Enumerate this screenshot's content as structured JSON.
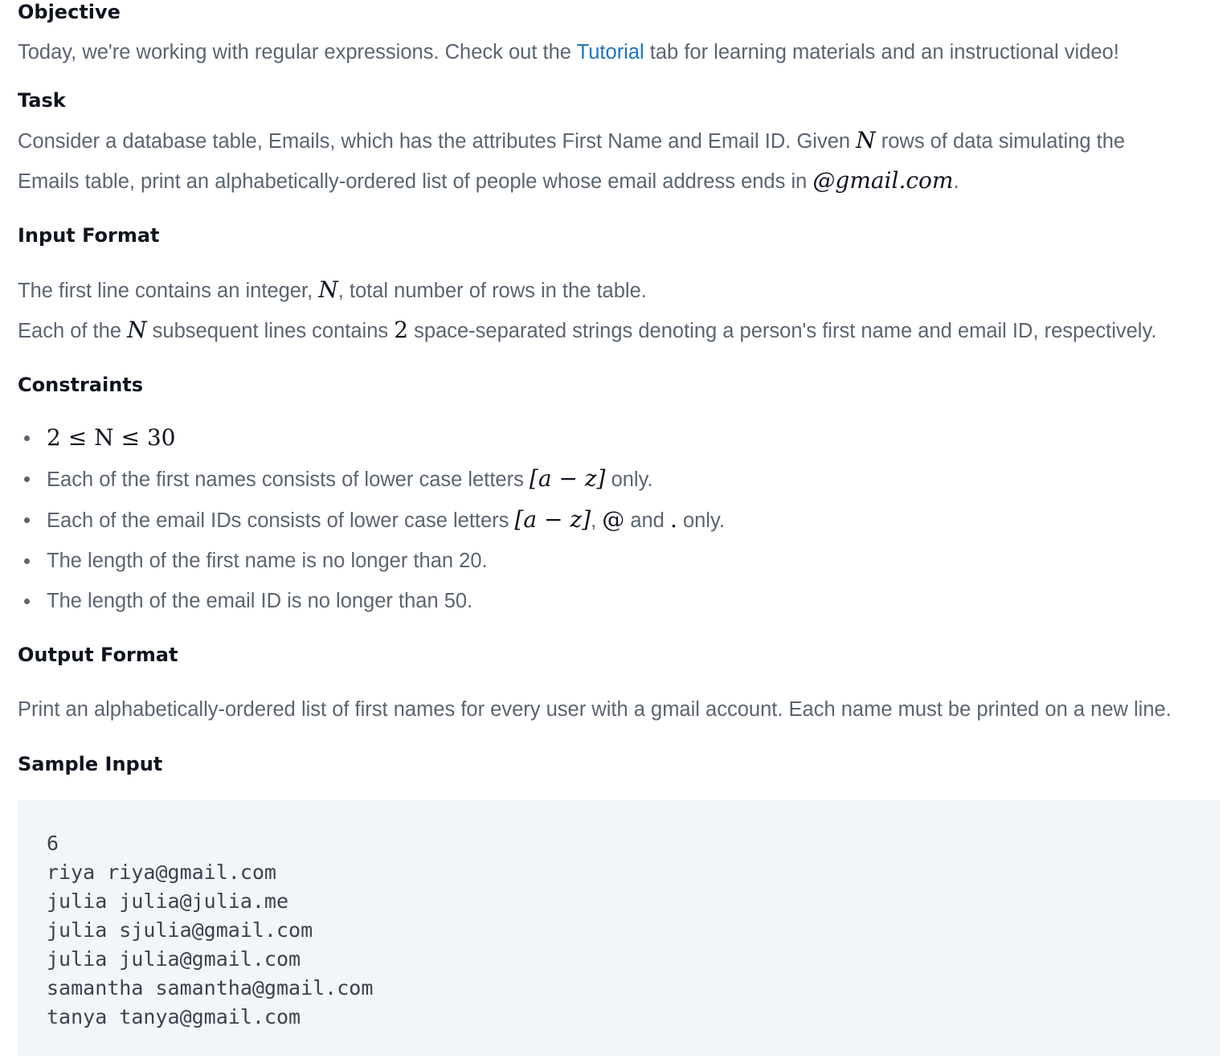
{
  "objective": {
    "heading": "Objective",
    "text_before": "Today, we're working with regular expressions. Check out the ",
    "link": "Tutorial",
    "text_after": " tab for learning materials and an instructional video!"
  },
  "task": {
    "heading": "Task",
    "line1_before": "Consider a database table, Emails, which has the attributes First Name and Email ID. Given ",
    "line1_var": "N",
    "line1_after": " rows of data simulating the",
    "line2_before": "Emails table, print an alphabetically-ordered list of people whose email address ends in ",
    "line2_math": "@gmail.com",
    "line2_after": "."
  },
  "input_format": {
    "heading": "Input Format",
    "line1_before": "The first line contains an integer, ",
    "line1_var": "N",
    "line1_after": ", total number of rows in the table.",
    "line2_before": "Each of the ",
    "line2_var": "N",
    "line2_mid": " subsequent lines contains ",
    "line2_num": "2",
    "line2_after": " space-separated strings denoting a person's first name and email ID, respectively."
  },
  "constraints": {
    "heading": "Constraints",
    "c1": "2 ≤ N ≤ 30",
    "c2_before": "Each of the first names consists of lower case letters ",
    "c2_math": "[a − z]",
    "c2_after": " only.",
    "c3_before": "Each of the email IDs consists of lower case letters ",
    "c3_math": "[a − z]",
    "c3_comma": ", ",
    "c3_at": "@",
    "c3_and": " and ",
    "c3_dot": ".",
    "c3_after": " only.",
    "c4": "The length of the first name is no longer than 20.",
    "c5": "The length of the email ID is no longer than 50."
  },
  "output_format": {
    "heading": "Output Format",
    "text": "Print an alphabetically-ordered list of first names for every user with a gmail account. Each name must be printed on a new line."
  },
  "sample_input": {
    "heading": "Sample Input",
    "lines": [
      "6",
      "riya riya@gmail.com",
      "julia julia@julia.me",
      "julia sjulia@gmail.com",
      "julia julia@gmail.com",
      "samantha samantha@gmail.com",
      "tanya tanya@gmail.com"
    ]
  }
}
